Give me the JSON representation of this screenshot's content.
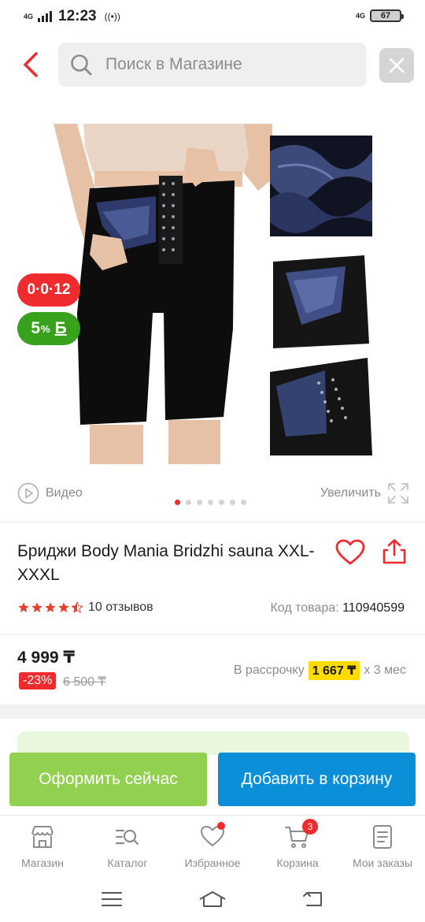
{
  "status_bar": {
    "network": "4G",
    "time": "12:23",
    "radio_icon": "((•))",
    "network_right": "4G",
    "battery": "67"
  },
  "search": {
    "placeholder": "Поиск в Магазине"
  },
  "badges": {
    "installment": "0·0·12",
    "bonus_value": "5",
    "bonus_percent": "%",
    "bonus_currency": "Б"
  },
  "media": {
    "video_label": "Видео",
    "zoom_label": "Увеличить",
    "slides_count": 7,
    "active_slide": 1
  },
  "product": {
    "title": "Бриджи Body Mania Bridzhi sauna XXL-XXXL",
    "rating": 4.5,
    "reviews": "10 отзывов",
    "code_label": "Код товара:",
    "code_value": "110940599"
  },
  "pricing": {
    "price": "4 999 ₸",
    "discount": "-23%",
    "old_price": "6 500 ₸",
    "installment_label": "В рассрочку",
    "installment_amount": "1 667 ₸",
    "installment_term": "x 3 мес"
  },
  "actions": {
    "buy_now": "Оформить сейчас",
    "add_to_cart": "Добавить в корзину"
  },
  "tabs": [
    {
      "label": "Магазин",
      "icon": "store-icon"
    },
    {
      "label": "Каталог",
      "icon": "catalog-icon"
    },
    {
      "label": "Избранное",
      "icon": "heart-icon"
    },
    {
      "label": "Корзина",
      "icon": "cart-icon",
      "badge": "3"
    },
    {
      "label": "Мои заказы",
      "icon": "orders-icon"
    }
  ],
  "colors": {
    "accent_red": "#ef2b2d",
    "bonus_green": "#39a21d",
    "buy_now_green": "#92d14f",
    "cart_blue": "#0b8fd8",
    "installment_yellow": "#ffdc00"
  }
}
